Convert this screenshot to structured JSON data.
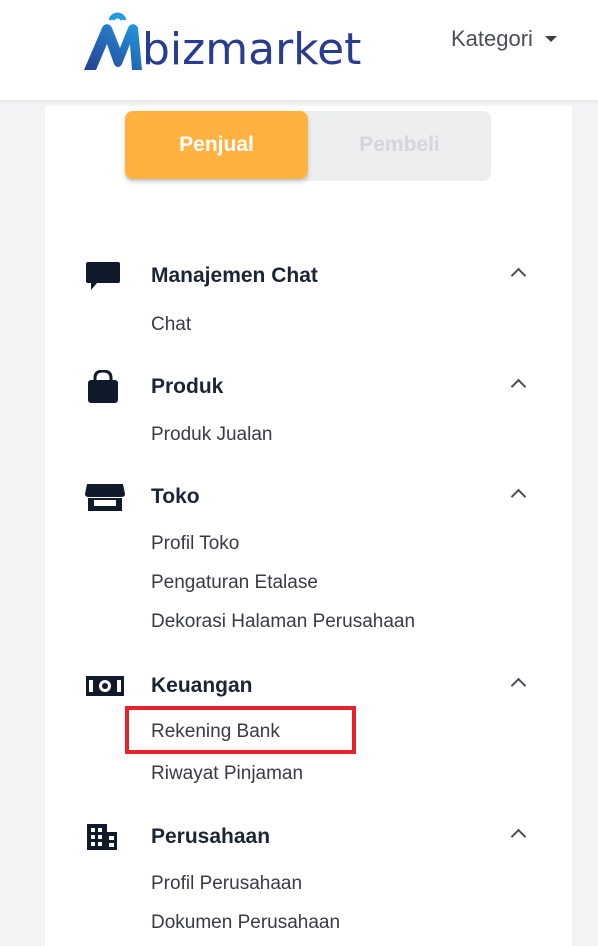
{
  "header": {
    "brand_text": "bizmarket",
    "category_label": "Kategori",
    "colors": {
      "brand": "#2a3c8f",
      "brand_accent": "#1e9be0"
    }
  },
  "role_toggle": {
    "seller_label": "Penjual",
    "buyer_label": "Pembeli",
    "active": "Penjual",
    "active_color": "#ffb23f"
  },
  "menu": {
    "sections": [
      {
        "title": "Manajemen Chat",
        "icon": "chat-icon",
        "expanded": true,
        "items": [
          "Chat"
        ]
      },
      {
        "title": "Produk",
        "icon": "shopping-bag-icon",
        "expanded": true,
        "items": [
          "Produk Jualan"
        ]
      },
      {
        "title": "Toko",
        "icon": "store-icon",
        "expanded": true,
        "items": [
          "Profil Toko",
          "Pengaturan Etalase",
          "Dekorasi Halaman Perusahaan"
        ]
      },
      {
        "title": "Keuangan",
        "icon": "money-icon",
        "expanded": true,
        "items": [
          "Rekening Bank",
          "Riwayat Pinjaman"
        ]
      },
      {
        "title": "Perusahaan",
        "icon": "building-icon",
        "expanded": true,
        "items": [
          "Profil Perusahaan",
          "Dokumen Perusahaan"
        ]
      }
    ],
    "highlighted_item": "Rekening Bank",
    "highlight_color": "#e8202a"
  }
}
